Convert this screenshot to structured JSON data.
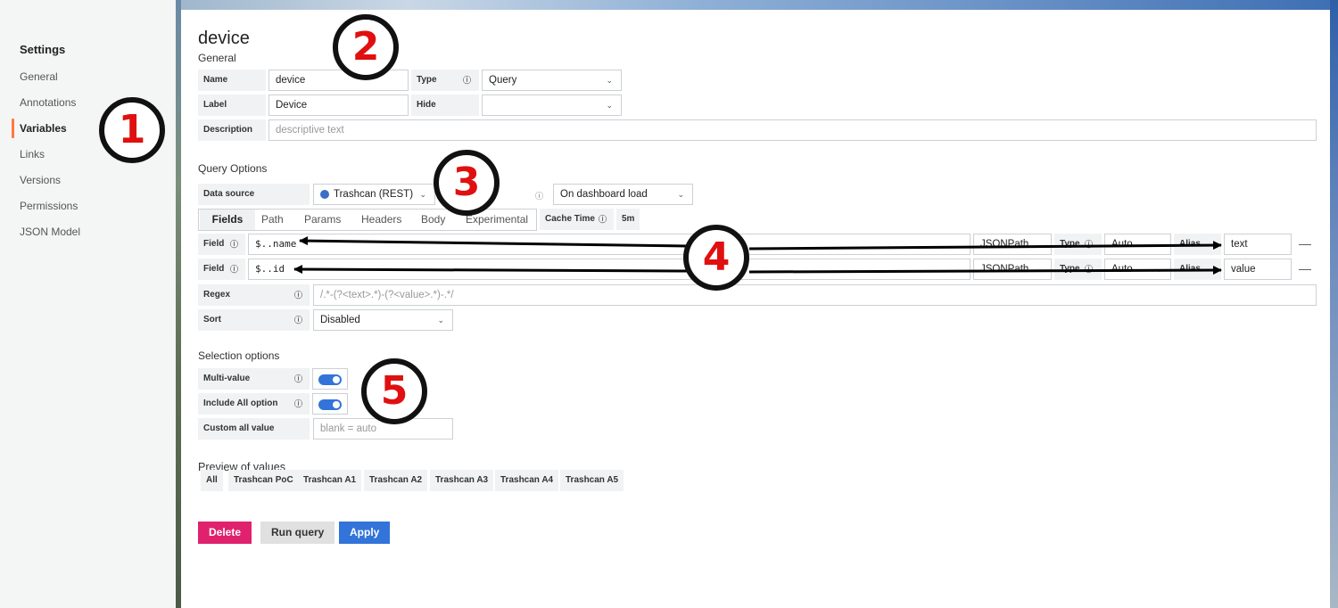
{
  "sidebar": {
    "title": "Settings",
    "items": [
      {
        "label": "General"
      },
      {
        "label": "Annotations"
      },
      {
        "label": "Variables"
      },
      {
        "label": "Links"
      },
      {
        "label": "Versions"
      },
      {
        "label": "Permissions"
      },
      {
        "label": "JSON Model"
      }
    ],
    "active_index": 2,
    "accent_color": "#ff7941"
  },
  "page": {
    "title": "device",
    "general_label": "General"
  },
  "general": {
    "name_label": "Name",
    "name_value": "device",
    "type_label": "Type",
    "type_value": "Query",
    "label_label": "Label",
    "label_value": "Device",
    "hide_label": "Hide",
    "hide_value": "",
    "description_label": "Description",
    "description_placeholder": "descriptive text"
  },
  "query_options": {
    "section_label": "Query Options",
    "datasource_label": "Data source",
    "datasource_value": "Trashcan (REST)",
    "refresh_value": "On dashboard load",
    "tabs": [
      "Fields",
      "Path",
      "Params",
      "Headers",
      "Body",
      "Experimental"
    ],
    "active_tab": "Fields",
    "cache_time_label": "Cache Time",
    "cache_time_value": "5m",
    "fields": [
      {
        "label": "Field",
        "path": "$..name",
        "parser": "JSONPath",
        "type_label": "Type",
        "type_value": "Auto",
        "alias_label": "Alias",
        "alias_value": "text"
      },
      {
        "label": "Field",
        "path": "$..id",
        "parser": "JSONPath",
        "type_label": "Type",
        "type_value": "Auto",
        "alias_label": "Alias",
        "alias_value": "value"
      }
    ],
    "regex_label": "Regex",
    "regex_placeholder": "/.*-(?<text>.*)-(?<value>.*)-.*/",
    "sort_label": "Sort",
    "sort_value": "Disabled"
  },
  "selection_options": {
    "section_label": "Selection options",
    "multi_value_label": "Multi-value",
    "multi_value": true,
    "include_all_label": "Include All option",
    "include_all": true,
    "custom_all_label": "Custom all value",
    "custom_all_placeholder": "blank = auto"
  },
  "preview": {
    "section_label": "Preview of values",
    "values": [
      "All",
      "Trashcan PoC",
      "Trashcan A1",
      "Trashcan A2",
      "Trashcan A3",
      "Trashcan A4",
      "Trashcan A5"
    ]
  },
  "buttons": {
    "delete": "Delete",
    "run_query": "Run query",
    "apply": "Apply"
  },
  "annotations": {
    "badges": [
      "1",
      "2",
      "3",
      "4",
      "5"
    ],
    "badge_color": "#e01010"
  },
  "icons": {
    "info": "ⓘ",
    "chevron": "⌄",
    "minus": "—"
  }
}
